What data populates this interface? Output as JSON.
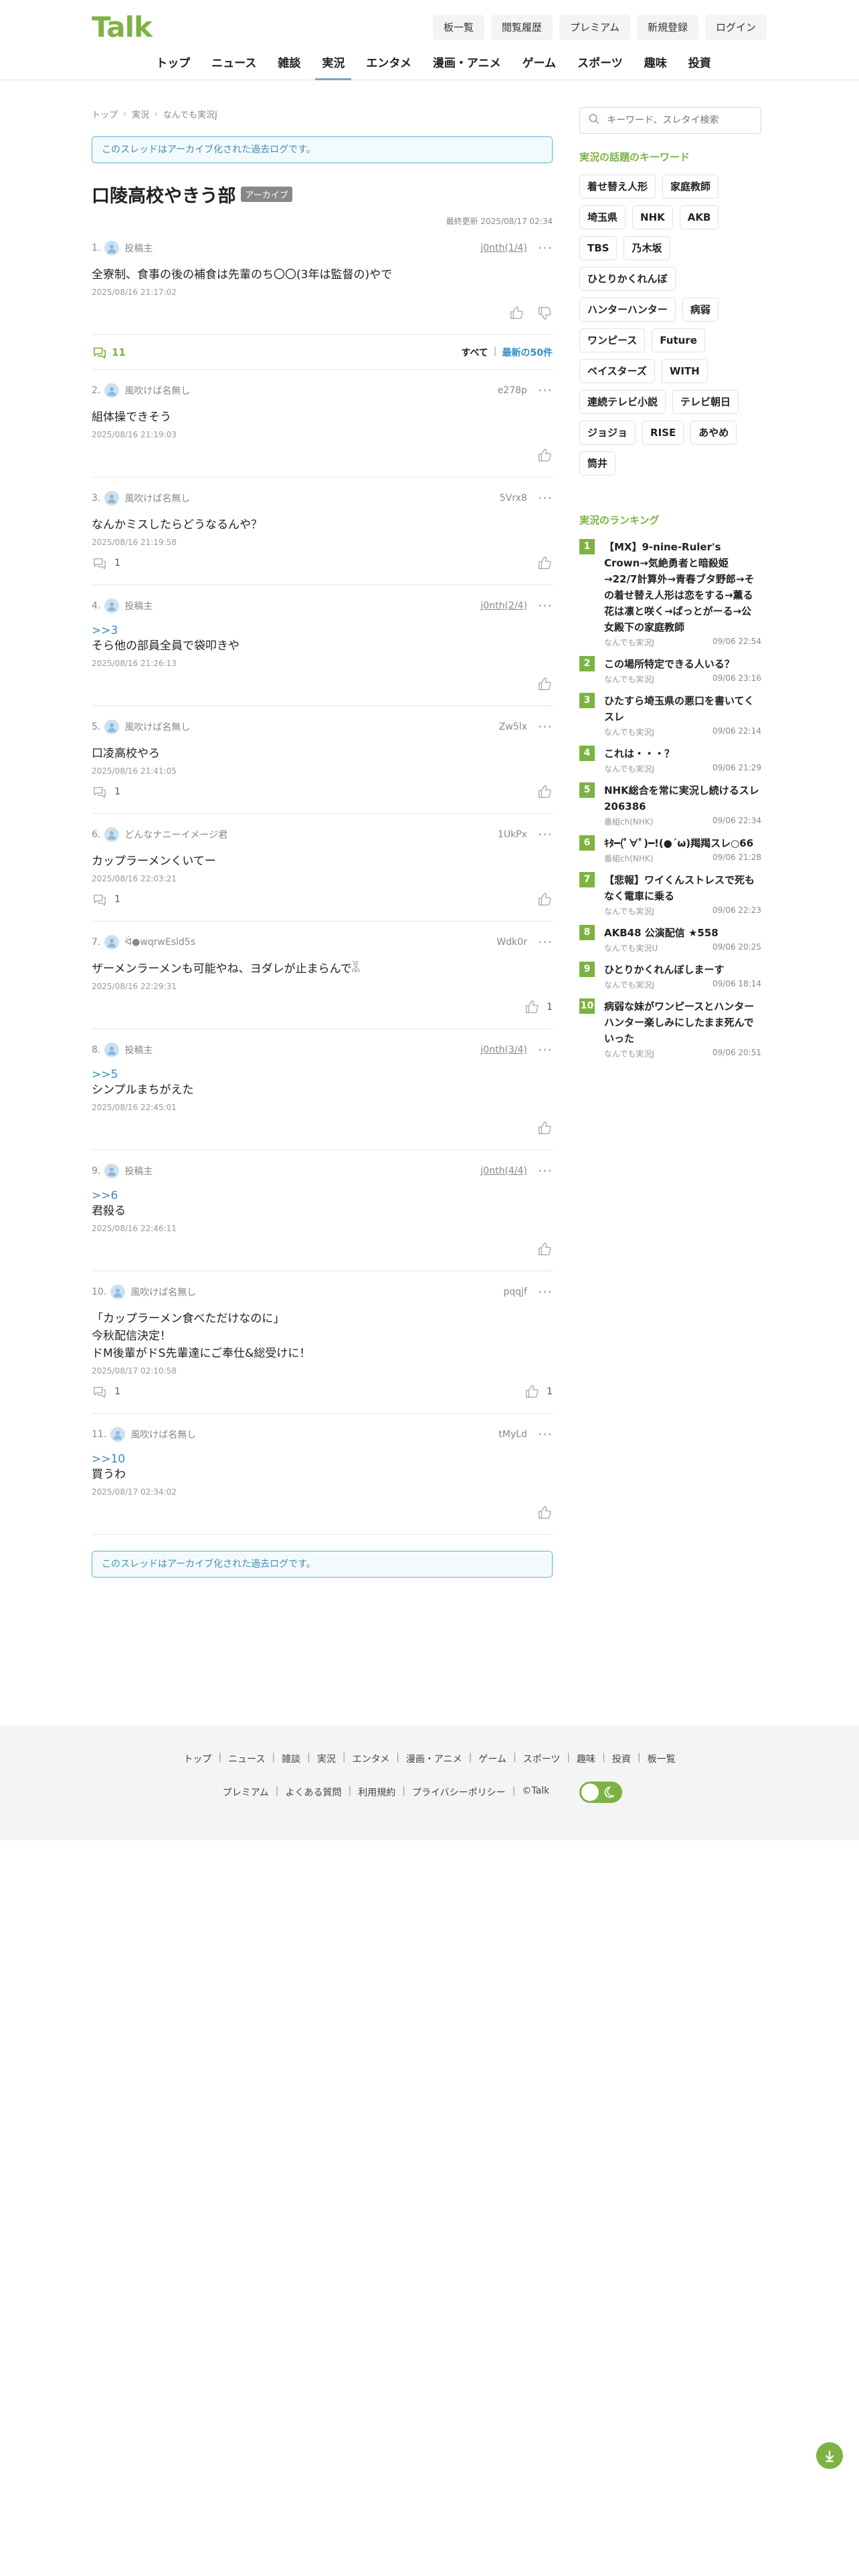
{
  "header": {
    "logo": "Talk",
    "top_links": [
      "板一覧",
      "閲覧履歴",
      "プレミアム",
      "新規登録",
      "ログイン"
    ],
    "nav": [
      "トップ",
      "ニュース",
      "雑談",
      "実況",
      "エンタメ",
      "漫画・アニメ",
      "ゲーム",
      "スポーツ",
      "趣味",
      "投資"
    ],
    "active_nav": "実況"
  },
  "breadcrumb": [
    "トップ",
    "実況",
    "なんでも実況J"
  ],
  "archive_notice": "このスレッドはアーカイブ化された過去ログです。",
  "thread": {
    "title": "口陵高校やきう部",
    "badge": "アーカイブ",
    "updated": "最終更新 2025/08/17 02:34"
  },
  "stats": {
    "count": "11",
    "filter_all": "すべて",
    "filter_latest": "最新の50件"
  },
  "posts": [
    {
      "num": "1.",
      "name": "投稿主",
      "id": "j0nth(1/4)",
      "id_link": true,
      "reply": "",
      "body": [
        "全寮制、食事の後の補食は先輩のち〇〇(3年は監督の)やで"
      ],
      "date": "2025/08/16 21:17:02",
      "replies": "",
      "likes": "",
      "dislike": true
    },
    {
      "num": "2.",
      "name": "風吹けば名無し",
      "id": "e278p",
      "id_link": false,
      "reply": "",
      "body": [
        "組体操できそう"
      ],
      "date": "2025/08/16 21:19:03",
      "replies": "",
      "likes": "",
      "dislike": false
    },
    {
      "num": "3.",
      "name": "風吹けば名無し",
      "id": "5Vrx8",
      "id_link": false,
      "reply": "",
      "body": [
        "なんかミスしたらどうなるんや？"
      ],
      "date": "2025/08/16 21:19:58",
      "replies": "1",
      "likes": "",
      "dislike": false
    },
    {
      "num": "4.",
      "name": "投稿主",
      "id": "j0nth(2/4)",
      "id_link": true,
      "reply": ">>3",
      "body": [
        "そら他の部員全員で袋叩きや"
      ],
      "date": "2025/08/16 21:26:13",
      "replies": "",
      "likes": "",
      "dislike": false
    },
    {
      "num": "5.",
      "name": "風吹けば名無し",
      "id": "Zw5lx",
      "id_link": false,
      "reply": "",
      "body": [
        "口凌高校やろ"
      ],
      "date": "2025/08/16 21:41:05",
      "replies": "1",
      "likes": "",
      "dislike": false
    },
    {
      "num": "6.",
      "name": "どんなナニーイメージ君",
      "id": "1UkPx",
      "id_link": false,
      "reply": "",
      "body": [
        "カップラーメンくいてー"
      ],
      "date": "2025/08/16 22:03:21",
      "replies": "1",
      "likes": "",
      "dislike": false
    },
    {
      "num": "7.",
      "name": "ᐛ●wqrwEsld5s",
      "id": "Wdk0r",
      "id_link": false,
      "reply": "",
      "body": [
        "ザーメンラーメンも可能やね、ヨダレが止まらんで𓀡"
      ],
      "date": "2025/08/16 22:29:31",
      "replies": "",
      "likes": "1",
      "dislike": false
    },
    {
      "num": "8.",
      "name": "投稿主",
      "id": "j0nth(3/4)",
      "id_link": true,
      "reply": ">>5",
      "body": [
        "シンプルまちがえた"
      ],
      "date": "2025/08/16 22:45:01",
      "replies": "",
      "likes": "",
      "dislike": false
    },
    {
      "num": "9.",
      "name": "投稿主",
      "id": "j0nth(4/4)",
      "id_link": true,
      "reply": ">>6",
      "body": [
        "君殺る"
      ],
      "date": "2025/08/16 22:46:11",
      "replies": "",
      "likes": "",
      "dislike": false
    },
    {
      "num": "10.",
      "name": "風吹けば名無し",
      "id": "pqqjf",
      "id_link": false,
      "reply": "",
      "body": [
        "「カップラーメン食べただけなのに」",
        "今秋配信決定！",
        "ドM後輩がドS先輩達にご奉仕&総受けに！"
      ],
      "date": "2025/08/17 02:10:58",
      "replies": "1",
      "likes": "1",
      "dislike": false
    },
    {
      "num": "11.",
      "name": "風吹けば名無し",
      "id": "tMyLd",
      "id_link": false,
      "reply": ">>10",
      "body": [
        "買うわ"
      ],
      "date": "2025/08/17 02:34:02",
      "replies": "",
      "likes": "",
      "dislike": false
    }
  ],
  "sidebar": {
    "search_placeholder": "キーワード、スレタイ検索",
    "keywords_heading": "実況の話題のキーワード",
    "keywords": [
      "着せ替え人形",
      "家庭教師",
      "埼玉県",
      "NHK",
      "AKB",
      "TBS",
      "乃木坂",
      "ひとりかくれんぼ",
      "ハンターハンター",
      "病弱",
      "ワンピース",
      "Future",
      "ベイスターズ",
      "WITH",
      "連続テレビ小説",
      "テレビ朝日",
      "ジョジョ",
      "RISE",
      "あやめ",
      "筒井"
    ],
    "ranking_heading": "実況のランキング",
    "ranking": [
      {
        "n": "1",
        "title": "【MX】9-nine-Ruler's Crown→気絶勇者と暗殺姫→22/7計算外→青春ブタ野郎→その着せ替え人形は恋をする→薫る花は凛と咲く→ぱっとがーる→公女殿下の家庭教師",
        "board": "なんでも実況J",
        "date": "09/06 22:54"
      },
      {
        "n": "2",
        "title": "この場所特定できる人いる？",
        "board": "なんでも実況J",
        "date": "09/06 23:16"
      },
      {
        "n": "3",
        "title": "ひたすら埼玉県の悪口を書いてくスレ",
        "board": "なんでも実況J",
        "date": "09/06 22:14"
      },
      {
        "n": "4",
        "title": "これは・・・？",
        "board": "なんでも実況J",
        "date": "09/06 21:29"
      },
      {
        "n": "5",
        "title": "NHK総合を常に実況し続けるスレ 206386",
        "board": "番組ch(NHK)",
        "date": "09/06 22:34"
      },
      {
        "n": "6",
        "title": "ｷﾀ━(ﾟ∀ﾟ)━!(●´ω)羯羯スレ○66",
        "board": "番組ch(NHK)",
        "date": "09/06 21:28"
      },
      {
        "n": "7",
        "title": "【悲報】ワイくんストレスで死もなく電車に乗る",
        "board": "なんでも実況J",
        "date": "09/06 22:23"
      },
      {
        "n": "8",
        "title": "AKB48 公演配信 ★558",
        "board": "なんでも実況U",
        "date": "09/06 20:25"
      },
      {
        "n": "9",
        "title": "ひとりかくれんぼしまーす",
        "board": "なんでも実況J",
        "date": "09/06 18:14"
      },
      {
        "n": "10",
        "title": "病弱な妹がワンピースとハンターハンター楽しみにしたまま死んでいった",
        "board": "なんでも実況J",
        "date": "09/06 20:51"
      }
    ]
  },
  "footer": {
    "row1": [
      "トップ",
      "ニュース",
      "雑談",
      "実況",
      "エンタメ",
      "漫画・アニメ",
      "ゲーム",
      "スポーツ",
      "趣味",
      "投資",
      "板一覧"
    ],
    "row2": [
      "プレミアム",
      "よくある質問",
      "利用規約",
      "プライバシーポリシー",
      "©Talk"
    ]
  },
  "colors": {
    "brand": "#7cb342",
    "link": "#3a8bc4",
    "notice_border": "#5fb2cf"
  },
  "icons": [
    "search-icon",
    "user-avatar-icon",
    "more-icon",
    "reply-icon",
    "thumb-up-icon",
    "thumb-down-icon",
    "moon-icon",
    "arrow-down-icon"
  ]
}
